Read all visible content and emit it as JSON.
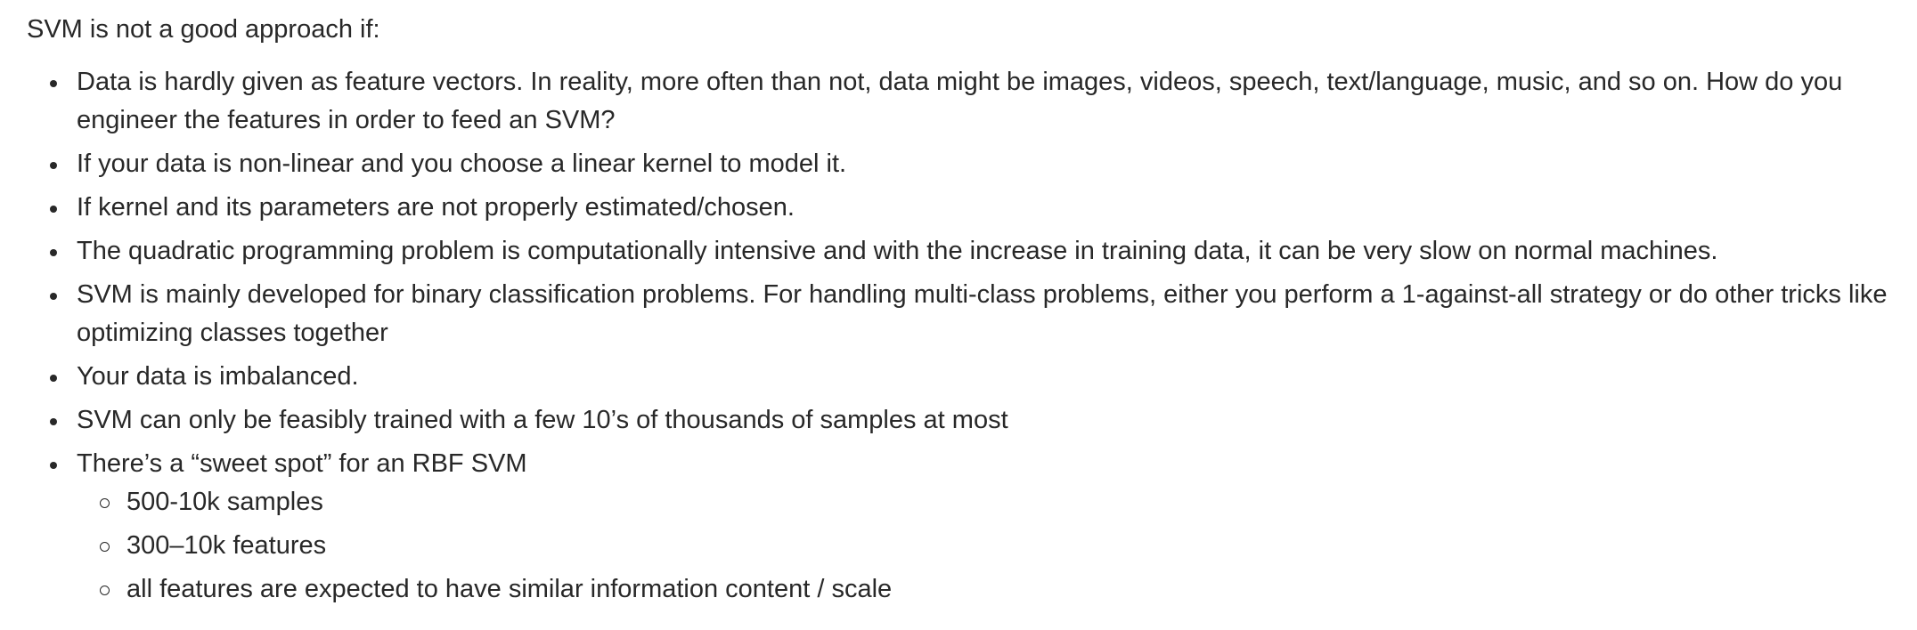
{
  "intro": "SVM is not a good approach if:",
  "items": [
    "Data is hardly given as feature vectors. In reality, more often than not, data might be images, videos, speech, text/language, music, and so on. How do you engineer the features in order to feed an SVM?",
    "If your data is non-linear and you choose a linear kernel to model it.",
    "If kernel and its parameters are not properly estimated/chosen.",
    "The quadratic programming problem is computationally intensive and with the increase in training data, it can be very slow on normal machines.",
    "SVM is mainly developed for binary classification problems. For handling multi-class problems, either you perform a 1-against-all strategy or do other tricks like optimizing classes together",
    "Your data is imbalanced.",
    "SVM can only be feasibly trained with a few 10’s of thousands of samples at most",
    "There’s a “sweet spot” for an RBF SVM"
  ],
  "subitems": [
    "500-10k samples",
    "300–10k features",
    "all features are expected to have similar information content / scale"
  ]
}
